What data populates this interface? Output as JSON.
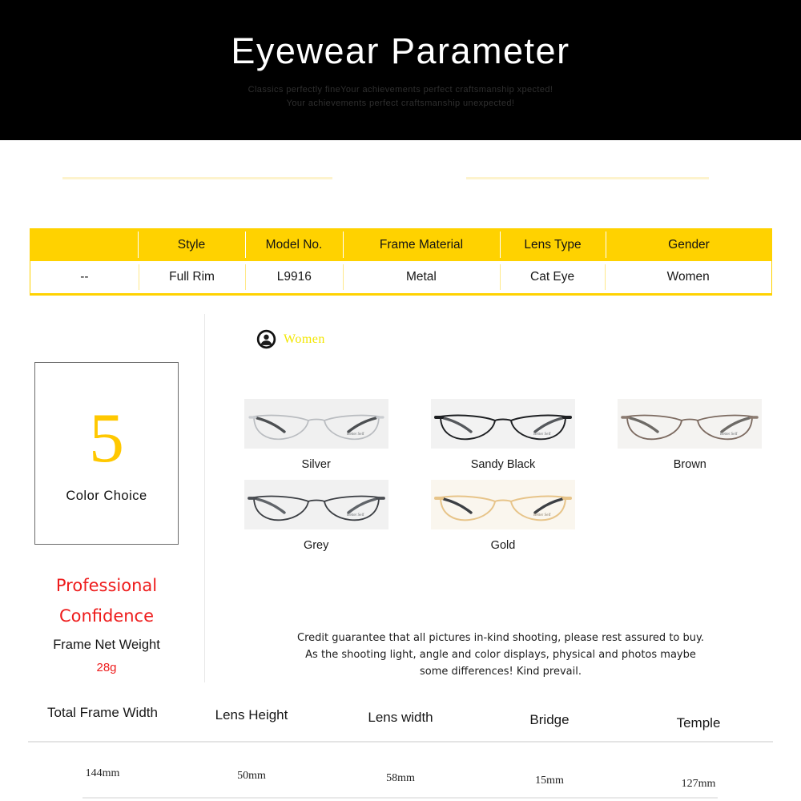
{
  "hero": {
    "title": "Eyewear Parameter",
    "subtitle_line1": "Classics perfectly fineYour  achievements perfect craftsmanship xpected!",
    "subtitle_line2": "Your achievements perfect craftsmanship unexpected!",
    "background_color": "#000000"
  },
  "accent": {
    "yellow": "#FFD200",
    "pale_yellow": "#FDF3CD",
    "red": "#EE1C1C",
    "gold_number": "#FFC800",
    "gender_yellow": "#F2E600"
  },
  "spec_table": {
    "headers": [
      "",
      "Style",
      "Model No.",
      "Frame Material",
      "Lens Type",
      "Gender"
    ],
    "values": [
      "--",
      "Full Rim",
      "L9916",
      "Metal",
      "Cat Eye",
      "Women"
    ]
  },
  "left_panel": {
    "count": "5",
    "count_label": "Color Choice",
    "tagline_line1": "Professional",
    "tagline_line2": "Confidence",
    "net_weight_label": "Frame Net Weight",
    "net_weight_value": "28g"
  },
  "gender_badge": {
    "icon": "person-avatar-icon",
    "label": "Women"
  },
  "colors": [
    {
      "label": "Silver",
      "frame_color": "#b9bcc0",
      "temple_color": "#4c4f52",
      "bg": "#f0f0f0",
      "brand": "Better Self"
    },
    {
      "label": "Sandy Black",
      "frame_color": "#1d1f22",
      "temple_color": "#55585c",
      "bg": "#f2f2f2",
      "brand": "Better Self"
    },
    {
      "label": "Brown",
      "frame_color": "#7c6a60",
      "temple_color": "#6d6a66",
      "bg": "#f4f3f1",
      "brand": "Better Self"
    },
    {
      "label": "Grey",
      "frame_color": "#3a3d42",
      "temple_color": "#606469",
      "bg": "#f1f1f1",
      "brand": "Better Self"
    },
    {
      "label": "Gold",
      "frame_color": "#e7c489",
      "temple_color": "#3c3f43",
      "bg": "#faf6ee",
      "brand": "Better Self"
    }
  ],
  "credit_note": {
    "line1": "Credit guarantee that all pictures in-kind shooting, please rest assured to buy.",
    "line2": "As the shooting light, angle and color displays, physical and photos maybe",
    "line3": "some differences! Kind prevail."
  },
  "measurements": {
    "labels": [
      "Total Frame Width",
      "Lens Height",
      "Lens width",
      "Bridge",
      "Temple"
    ],
    "values": [
      "144mm",
      "50mm",
      "58mm",
      "15mm",
      "127mm"
    ]
  }
}
